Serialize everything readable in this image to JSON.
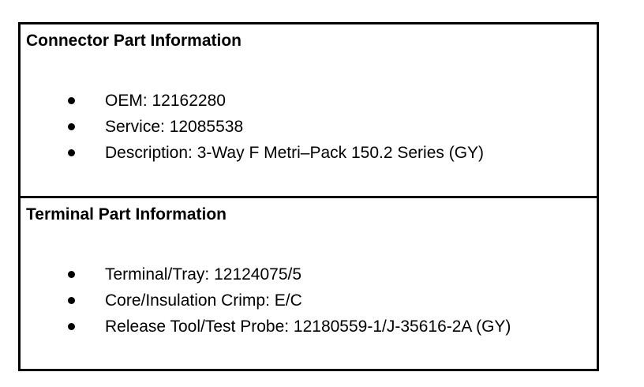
{
  "connector_section": {
    "title": "Connector Part Information",
    "items": [
      "OEM: 12162280",
      "Service: 12085538",
      "Description: 3-Way F Metri–Pack 150.2 Series (GY)"
    ]
  },
  "terminal_section": {
    "title": "Terminal Part Information",
    "items": [
      "Terminal/Tray: 12124075/5",
      "Core/Insulation Crimp: E/C",
      "Release Tool/Test Probe: 12180559-1/J-35616-2A (GY)"
    ]
  }
}
